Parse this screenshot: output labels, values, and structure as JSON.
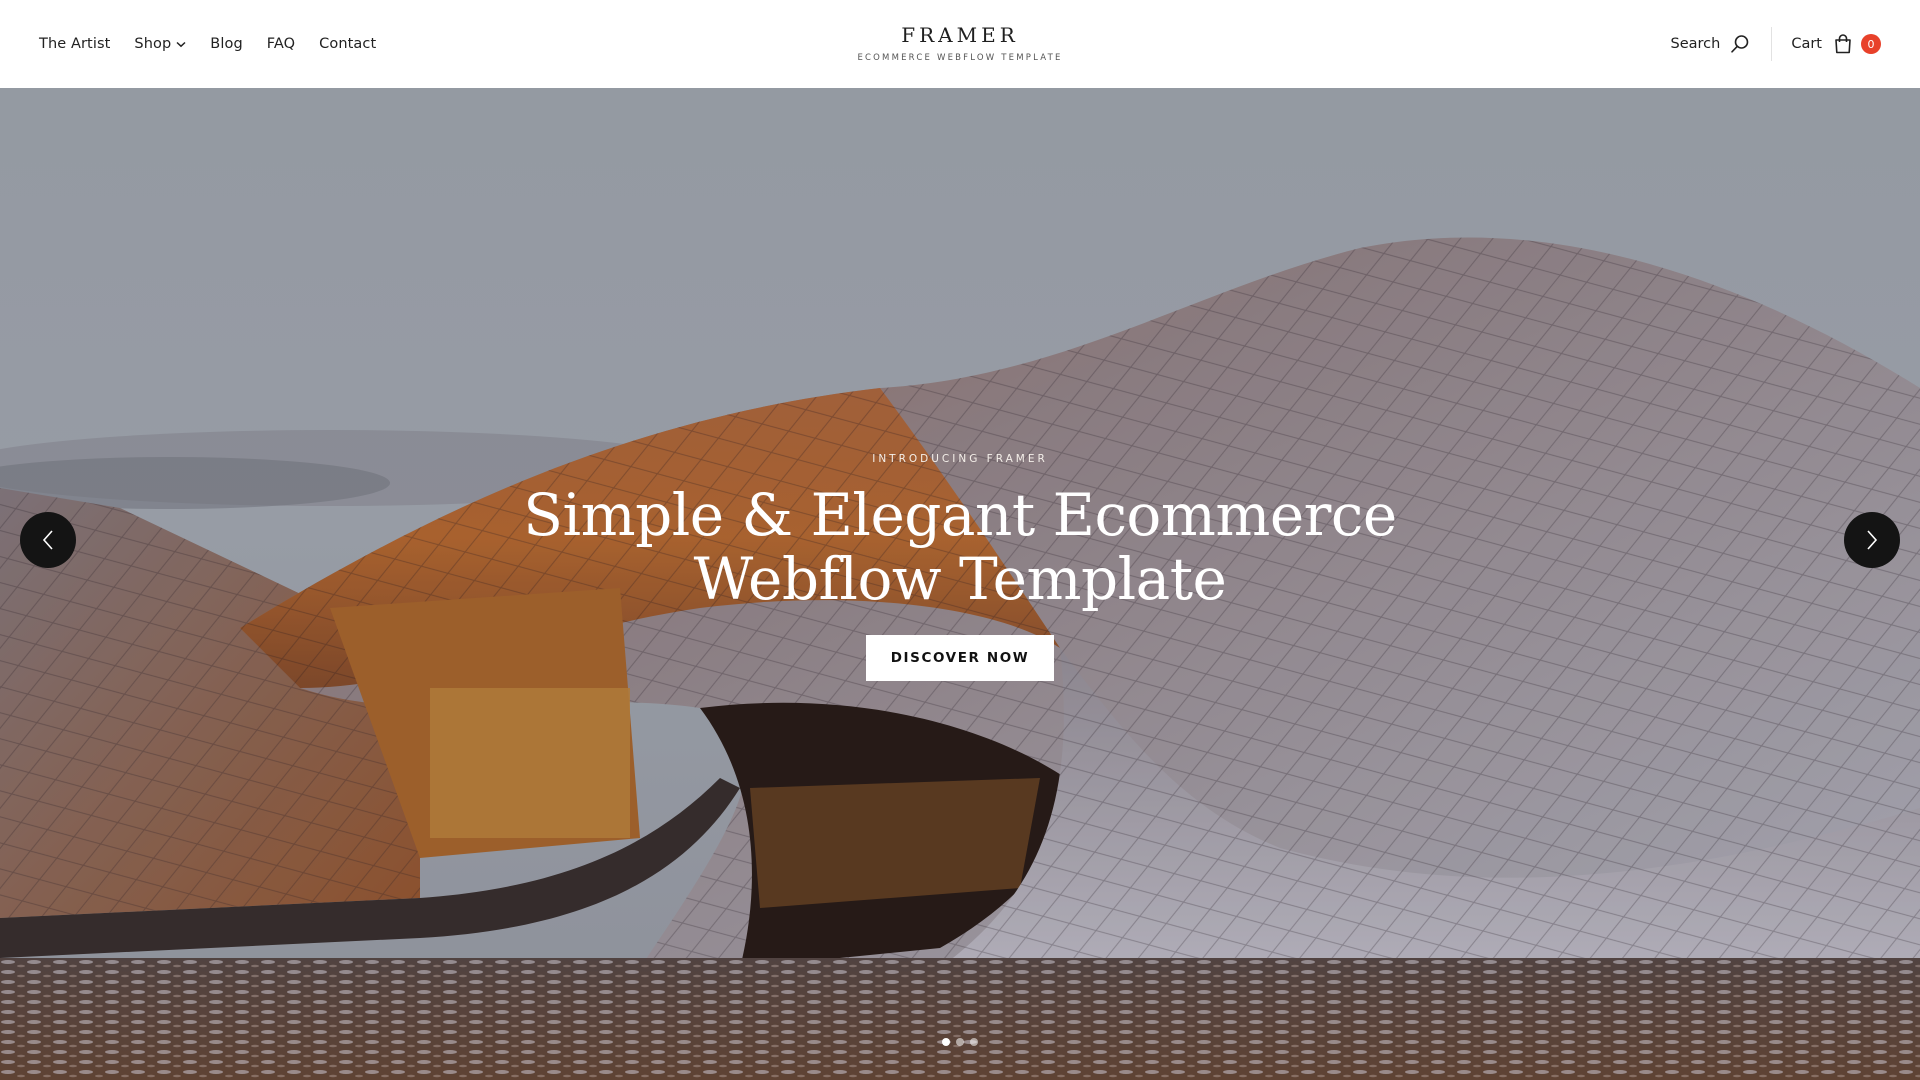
{
  "header": {
    "nav": [
      {
        "label": "The Artist"
      },
      {
        "label": "Shop",
        "has_dropdown": true
      },
      {
        "label": "Blog"
      },
      {
        "label": "FAQ"
      },
      {
        "label": "Contact"
      }
    ],
    "brand": {
      "name": "FRAMER",
      "tagline": "ECOMMERCE WEBFLOW TEMPLATE"
    },
    "search_label": "Search",
    "cart_label": "Cart",
    "cart_count": "0",
    "accent_color": "#e8412a"
  },
  "hero": {
    "eyebrow": "INTRODUCING FRAMER",
    "headline_line1": "Simple & Elegant Ecommerce",
    "headline_line2": "Webflow Template",
    "cta_label": "DISCOVER NOW",
    "slide_count": 3,
    "active_slide": 1
  },
  "icons": {
    "search": "search-icon",
    "cart": "shopping-bag-icon",
    "dropdown": "chevron-down-icon",
    "prev": "chevron-left-icon",
    "next": "chevron-right-icon"
  }
}
